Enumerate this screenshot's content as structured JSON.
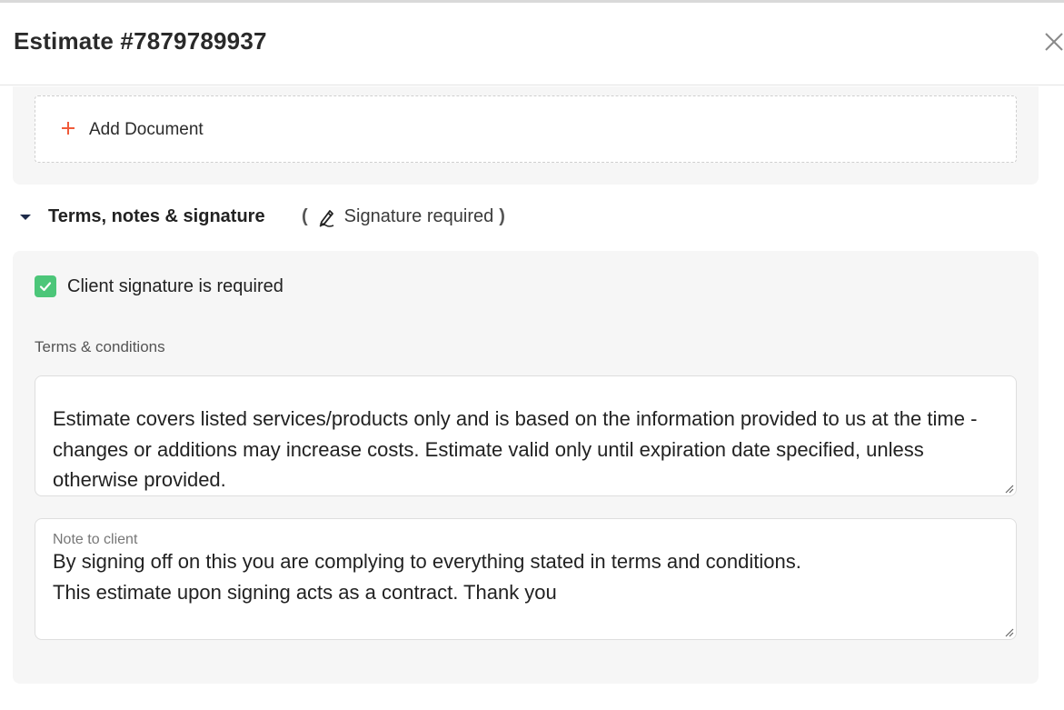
{
  "header": {
    "title": "Estimate #7879789937"
  },
  "documents": {
    "add_label": "Add Document"
  },
  "section": {
    "title": "Terms, notes & signature",
    "open_paren": "(",
    "signature_note": "Signature required",
    "close_paren": ")",
    "expanded": true
  },
  "signature": {
    "checkbox_label": "Client signature is required",
    "checked": true
  },
  "terms": {
    "label": "Terms & conditions",
    "value": "Estimate covers listed services/products only and is based on the information provided to us at the time - changes or additions may increase costs. Estimate valid only until expiration date specified, unless otherwise provided."
  },
  "note": {
    "label": "Note to client",
    "value": "By signing off on this you are complying to everything stated in terms and conditions.\nThis estimate upon signing acts as a contract. Thank you"
  },
  "icons": {
    "close": "close-icon",
    "plus": "plus-icon",
    "caret": "caret-down-icon",
    "signature": "pen-signature-icon",
    "check": "checkmark-icon",
    "resize": "resize-handle-icon"
  },
  "colors": {
    "accent_plus": "#f05a3a",
    "checkbox": "#4cc679",
    "panel_bg": "#f6f6f6"
  }
}
